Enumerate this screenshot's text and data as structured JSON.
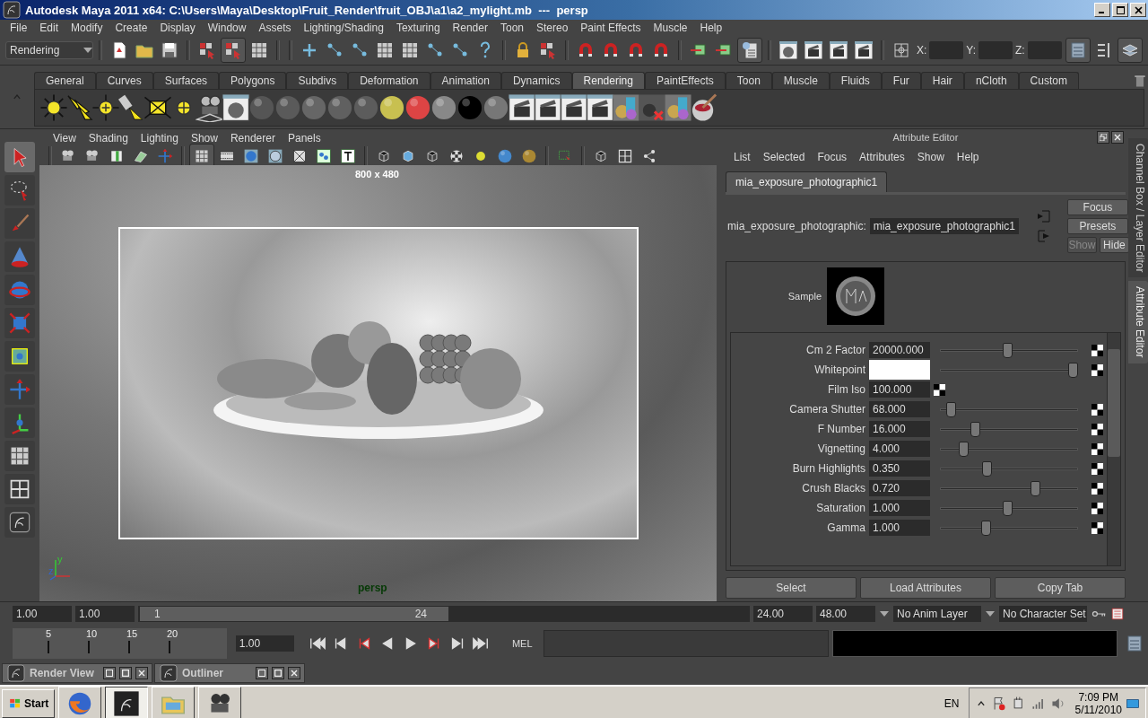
{
  "window": {
    "title": "Autodesk Maya 2011 x64: C:\\Users\\Maya\\Desktop\\Fruit_Render\\fruit_OBJ\\a1\\a2_mylight.mb  ---  persp"
  },
  "menu_bar": [
    "File",
    "Edit",
    "Modify",
    "Create",
    "Display",
    "Window",
    "Assets",
    "Lighting/Shading",
    "Texturing",
    "Render",
    "Toon",
    "Stereo",
    "Paint Effects",
    "Muscle",
    "Help"
  ],
  "status_line": {
    "menu_set": "Rendering",
    "x_label": "X:",
    "y_label": "Y:",
    "z_label": "Z:"
  },
  "shelf_tabs": [
    {
      "label": "General",
      "selected": false
    },
    {
      "label": "Curves",
      "selected": false
    },
    {
      "label": "Surfaces",
      "selected": false
    },
    {
      "label": "Polygons",
      "selected": false
    },
    {
      "label": "Subdivs",
      "selected": false
    },
    {
      "label": "Deformation",
      "selected": false
    },
    {
      "label": "Animation",
      "selected": false
    },
    {
      "label": "Dynamics",
      "selected": false
    },
    {
      "label": "Rendering",
      "selected": true
    },
    {
      "label": "PaintEffects",
      "selected": false
    },
    {
      "label": "Toon",
      "selected": false
    },
    {
      "label": "Muscle",
      "selected": false
    },
    {
      "label": "Fluids",
      "selected": false
    },
    {
      "label": "Fur",
      "selected": false
    },
    {
      "label": "Hair",
      "selected": false
    },
    {
      "label": "nCloth",
      "selected": false
    },
    {
      "label": "Custom",
      "selected": false
    }
  ],
  "viewport": {
    "menus": [
      "View",
      "Shading",
      "Lighting",
      "Show",
      "Renderer",
      "Panels"
    ],
    "resolution": "800 x 480",
    "camera": "persp",
    "axis_labels": [
      "y",
      "z"
    ]
  },
  "attribute_editor": {
    "title": "Attribute Editor",
    "menus": [
      "List",
      "Selected",
      "Focus",
      "Attributes",
      "Show",
      "Help"
    ],
    "tab": "mia_exposure_photographic1",
    "node_label": "mia_exposure_photographic:",
    "node_name": "mia_exposure_photographic1",
    "buttons": [
      {
        "label": "Focus",
        "disabled": false
      },
      {
        "label": "Presets",
        "disabled": false
      },
      {
        "label": "Show",
        "disabled": true
      },
      {
        "label": "Hide",
        "disabled": false
      }
    ],
    "sample_label": "Sample",
    "attributes": [
      {
        "kind": "slider",
        "label": "Cm 2 Factor",
        "value": "20000.000",
        "level": 0.49
      },
      {
        "kind": "color",
        "label": "Whitepoint",
        "color": "#ffffff",
        "level": 0.96
      },
      {
        "kind": "field",
        "label": "Film Iso",
        "value": "100.000"
      },
      {
        "kind": "slider",
        "label": "Camera Shutter",
        "value": "68.000",
        "level": 0.08
      },
      {
        "kind": "slider",
        "label": "F Number",
        "value": "16.000",
        "level": 0.25
      },
      {
        "kind": "slider",
        "label": "Vignetting",
        "value": "4.000",
        "level": 0.17
      },
      {
        "kind": "slider",
        "label": "Burn Highlights",
        "value": "0.350",
        "level": 0.34
      },
      {
        "kind": "slider",
        "label": "Crush Blacks",
        "value": "0.720",
        "level": 0.69
      },
      {
        "kind": "slider",
        "label": "Saturation",
        "value": "1.000",
        "level": 0.49
      },
      {
        "kind": "slider",
        "label": "Gamma",
        "value": "1.000",
        "level": 0.33
      }
    ],
    "footer_buttons": [
      "Select",
      "Load Attributes",
      "Copy Tab"
    ]
  },
  "side_tabs": [
    {
      "label": "Channel Box / Layer Editor",
      "selected": false
    },
    {
      "label": "Attribute Editor",
      "selected": true
    }
  ],
  "time_slider": {
    "start": "1.00",
    "playback_start": "1.00",
    "range_start": "1",
    "range_end": "24",
    "playback_end": "24.00",
    "end": "48.00",
    "anim_layer": "No Anim Layer",
    "character_set": "No Character Set"
  },
  "playback": {
    "ticks": [
      "5",
      "10",
      "15",
      "20"
    ],
    "current_time": "1.00",
    "command_label": "MEL"
  },
  "minimized_windows": [
    {
      "title": "Render View"
    },
    {
      "title": "Outliner"
    }
  ],
  "taskbar": {
    "start": "Start",
    "language": "EN",
    "time": "7:09 PM",
    "date": "5/11/2010"
  }
}
